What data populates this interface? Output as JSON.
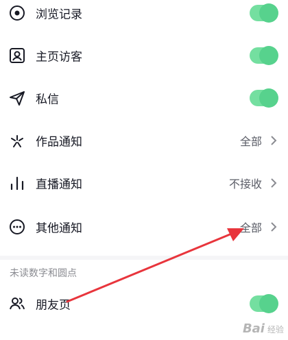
{
  "settings": {
    "browse_history": {
      "label": "浏览记录",
      "toggle_on": true
    },
    "profile_visitors": {
      "label": "主页访客",
      "toggle_on": true
    },
    "private_message": {
      "label": "私信",
      "toggle_on": true
    },
    "works_notification": {
      "label": "作品通知",
      "value": "全部"
    },
    "live_notification": {
      "label": "直播通知",
      "value": "不接收"
    },
    "other_notification": {
      "label": "其他通知",
      "value": "全部"
    },
    "friends_page": {
      "label": "朋友页",
      "toggle_on": true
    }
  },
  "section": {
    "unread_title": "未读数字和圆点"
  },
  "watermark": {
    "brand": "Bai",
    "sub": "经验"
  },
  "colors": {
    "toggle_track": "#74dfa0",
    "toggle_knob": "#57d28d",
    "annotation_arrow": "#e8353c"
  }
}
